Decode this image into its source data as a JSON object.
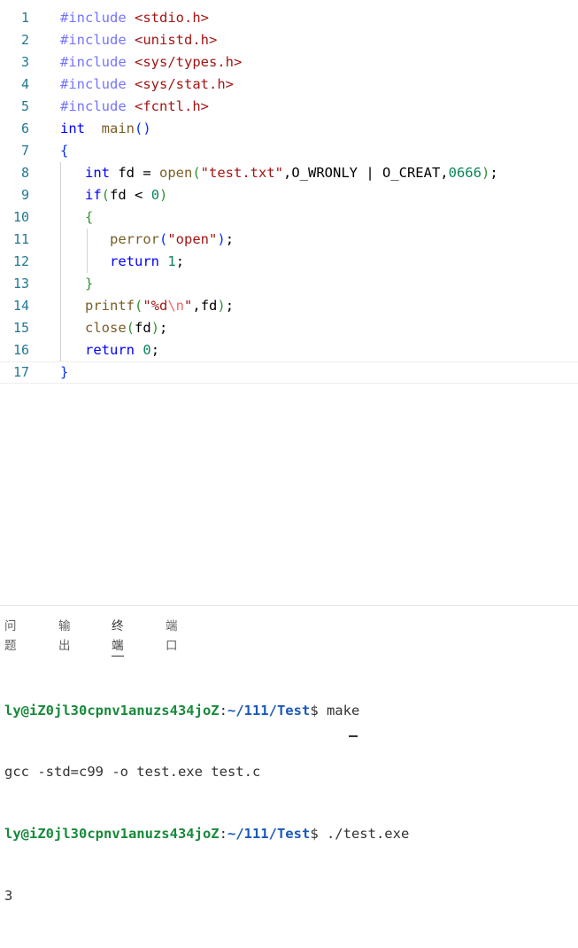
{
  "editor": {
    "lines": [
      {
        "n": "1",
        "tokens": [
          [
            "pp",
            "#include "
          ],
          [
            "inc",
            "<stdio.h>"
          ]
        ]
      },
      {
        "n": "2",
        "tokens": [
          [
            "pp",
            "#include "
          ],
          [
            "inc",
            "<unistd.h>"
          ]
        ]
      },
      {
        "n": "3",
        "tokens": [
          [
            "pp",
            "#include "
          ],
          [
            "inc",
            "<sys/types.h>"
          ]
        ]
      },
      {
        "n": "4",
        "tokens": [
          [
            "pp",
            "#include "
          ],
          [
            "inc",
            "<sys/stat.h>"
          ]
        ]
      },
      {
        "n": "5",
        "tokens": [
          [
            "pp",
            "#include "
          ],
          [
            "inc",
            "<fcntl.h>"
          ]
        ]
      },
      {
        "n": "6",
        "tokens": [
          [
            "kw",
            "int"
          ],
          [
            "",
            "  "
          ],
          [
            "fn",
            "main"
          ],
          [
            "b1",
            "()"
          ]
        ]
      },
      {
        "n": "7",
        "tokens": [
          [
            "b1",
            "{"
          ]
        ]
      },
      {
        "n": "8",
        "tokens": [
          [
            "",
            "   "
          ],
          [
            "kw",
            "int"
          ],
          [
            "",
            " fd = "
          ],
          [
            "fn",
            "open"
          ],
          [
            "b2",
            "("
          ],
          [
            "str",
            "\"test.txt\""
          ],
          [
            "",
            ",O_WRONLY | O_CREAT,"
          ],
          [
            "num",
            "0666"
          ],
          [
            "b2",
            ")"
          ],
          [
            "",
            ";"
          ]
        ]
      },
      {
        "n": "9",
        "tokens": [
          [
            "",
            "   "
          ],
          [
            "kw",
            "if"
          ],
          [
            "b2",
            "("
          ],
          [
            "",
            "fd < "
          ],
          [
            "num",
            "0"
          ],
          [
            "b2",
            ")"
          ]
        ]
      },
      {
        "n": "10",
        "tokens": [
          [
            "",
            "   "
          ],
          [
            "b2",
            "{"
          ]
        ]
      },
      {
        "n": "11",
        "tokens": [
          [
            "",
            "      "
          ],
          [
            "fn",
            "perror"
          ],
          [
            "b1",
            "("
          ],
          [
            "str",
            "\"open\""
          ],
          [
            "b1",
            ")"
          ],
          [
            "",
            ";"
          ]
        ]
      },
      {
        "n": "12",
        "tokens": [
          [
            "",
            "      "
          ],
          [
            "kw",
            "return"
          ],
          [
            "",
            " "
          ],
          [
            "num",
            "1"
          ],
          [
            "",
            ";"
          ]
        ]
      },
      {
        "n": "13",
        "tokens": [
          [
            "",
            "   "
          ],
          [
            "b2",
            "}"
          ]
        ]
      },
      {
        "n": "14",
        "tokens": [
          [
            "",
            "   "
          ],
          [
            "fn",
            "printf"
          ],
          [
            "b2",
            "("
          ],
          [
            "str",
            "\"%d"
          ],
          [
            "esc",
            "\\n"
          ],
          [
            "str",
            "\""
          ],
          [
            "",
            ",fd"
          ],
          [
            "b2",
            ")"
          ],
          [
            "",
            ";"
          ]
        ]
      },
      {
        "n": "15",
        "tokens": [
          [
            "",
            "   "
          ],
          [
            "fn",
            "close"
          ],
          [
            "b2",
            "("
          ],
          [
            "",
            "fd"
          ],
          [
            "b2",
            ")"
          ],
          [
            "",
            ";"
          ]
        ]
      },
      {
        "n": "16",
        "tokens": [
          [
            "",
            "   "
          ],
          [
            "kw",
            "return"
          ],
          [
            "",
            " "
          ],
          [
            "num",
            "0"
          ],
          [
            "",
            ";"
          ]
        ]
      },
      {
        "n": "17",
        "tokens": [
          [
            "b1",
            "}"
          ]
        ]
      }
    ]
  },
  "panel": {
    "tabs": [
      {
        "label": "问题",
        "active": false
      },
      {
        "label": "输出",
        "active": false
      },
      {
        "label": "终端",
        "active": true
      },
      {
        "label": "端口",
        "active": false
      }
    ]
  },
  "terminal": {
    "lines": [
      {
        "user": "ly@iZ0jl30cpnv1anuzs434joZ",
        "sep": ":",
        "path": "~/111/Test",
        "tail": "$ make"
      },
      {
        "text": "gcc -std=c99 -o test.exe test.c"
      },
      {
        "user": "ly@iZ0jl30cpnv1anuzs434joZ",
        "sep": ":",
        "path": "~/111/Test",
        "tail": "$ ./test.exe"
      },
      {
        "text": "3"
      }
    ]
  },
  "colors": {
    "keyword": "#0000ff",
    "function": "#795e26",
    "string": "#a31515",
    "number": "#098658",
    "line_number": "#237893",
    "prompt_user": "#188a3a",
    "prompt_path": "#1b59b8"
  }
}
